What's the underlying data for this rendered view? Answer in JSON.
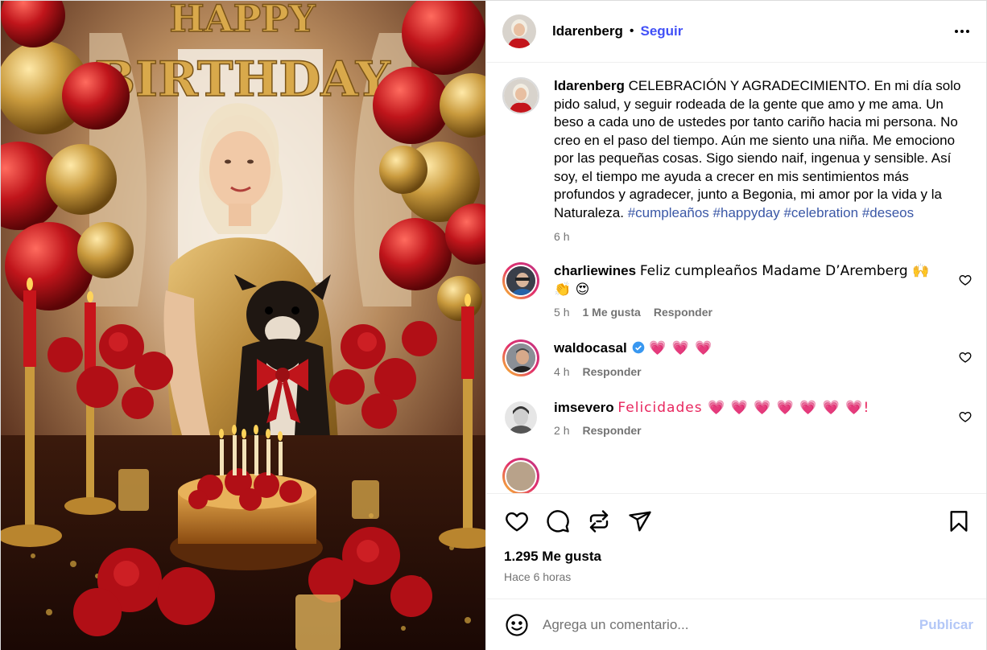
{
  "post": {
    "author": "ldarenberg",
    "separator": "•",
    "follow_label": "Seguir",
    "photo_banner": "HAPPY BIRTHDAY",
    "caption": {
      "user": "ldarenberg",
      "text": "CELEBRACIÓN Y AGRADECIMIENTO. En mi día solo pido salud, y seguir rodeada de la gente que amo y me ama. Un beso a cada uno de ustedes por tanto cariño hacia mi persona. No creo en el paso del tiempo. Aún me siento una niña. Me emociono por las pequeñas cosas. Sigo siendo naif, ingenua y sensible. Así soy, el tiempo me ayuda a crecer en mis sentimientos más profundos y agradecer, junto a Begonia, mi amor por la vida y la Naturaleza.",
      "hashtags": [
        "#cumpleaños",
        "#happyday",
        "#celebration",
        "#deseos"
      ],
      "time": "6 h"
    },
    "comments": [
      {
        "user": "charliewines",
        "text": "Feliz cumpleaños Madame D’Aremberg 🙌 👏 😍",
        "time": "5 h",
        "likes": "1 Me gusta",
        "reply": "Responder"
      },
      {
        "user": "waldocasal",
        "verified": true,
        "text": "💗 💗 💗",
        "time": "4 h",
        "reply": "Responder"
      },
      {
        "user": "imsevero",
        "text": "Felicidades 💗  💗 💗 💗 💗 💗 💗!",
        "time": "2 h",
        "reply": "Responder"
      }
    ],
    "likes_count": "1.295 Me gusta",
    "posted_ago": "Hace 6 horas",
    "comment_placeholder": "Agrega un comentario...",
    "publish_label": "Publicar"
  },
  "icons": {
    "like": "heart-icon",
    "comment": "comment-icon",
    "repost": "repost-icon",
    "share": "share-icon",
    "save": "bookmark-icon",
    "emoji": "emoji-icon",
    "more": "more-icon"
  },
  "colors": {
    "link": "#4150f7",
    "hashtag": "#3a57a6",
    "muted": "#737373",
    "publish_disabled": "#b3c7f7",
    "heart_emoji": "#e8265e"
  }
}
